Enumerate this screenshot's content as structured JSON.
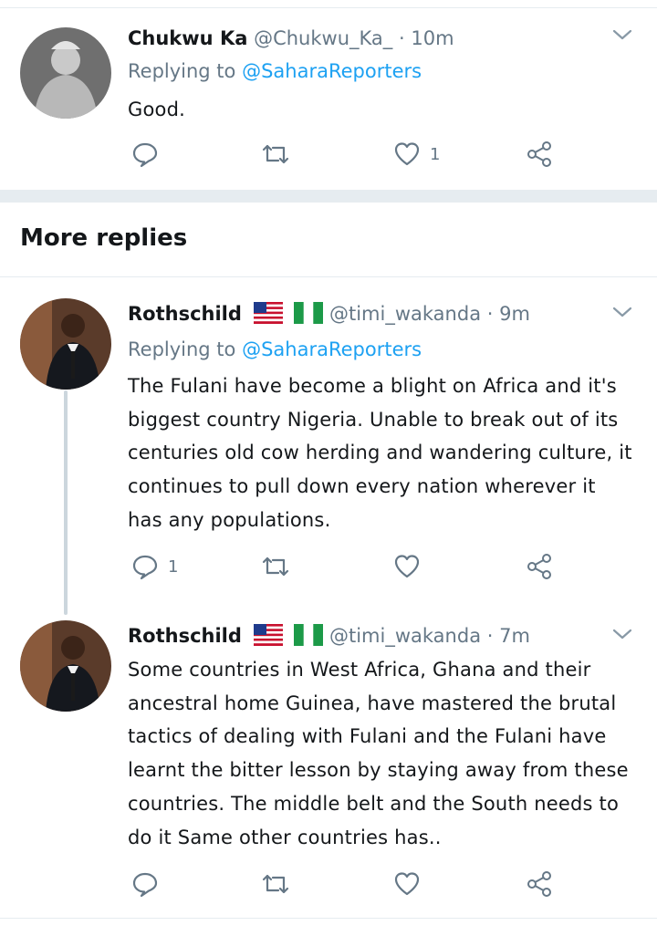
{
  "tweets": [
    {
      "name": "Chukwu Ka",
      "handle": "@Chukwu_Ka_",
      "separator": "·",
      "time": "10m",
      "replying_prefix": "Replying to",
      "replying_to": "@SaharaReporters",
      "text": "Good.",
      "reply_count": "",
      "like_count": "1"
    },
    {
      "name": "Rothschild",
      "flags": [
        "US flag",
        "Nigeria flag"
      ],
      "handle": "@timi_wakanda",
      "separator": "·",
      "time": "9m",
      "replying_prefix": "Replying to",
      "replying_to": "@SaharaReporters",
      "text": "The Fulani have become a blight on Africa and it's biggest country Nigeria. Unable to break out of its centuries old cow herding and wandering culture, it continues to pull down every nation wherever it has any populations.",
      "reply_count": "1",
      "like_count": ""
    },
    {
      "name": "Rothschild",
      "flags": [
        "US flag",
        "Nigeria flag"
      ],
      "handle": "@timi_wakanda",
      "separator": "·",
      "time": "7m",
      "text": "Some countries in West Africa, Ghana and their ancestral home Guinea, have mastered the brutal tactics of dealing with Fulani and the Fulani have learnt the bitter lesson by staying away from these countries. The middle belt and the South needs to do it Same other countries has..",
      "reply_count": "",
      "like_count": ""
    }
  ],
  "section_title": "More replies",
  "colors": {
    "text": "#14171a",
    "secondary": "#657786",
    "link": "#1da1f2",
    "divider": "#e6ecf0"
  },
  "icons": [
    "reply-icon",
    "retweet-icon",
    "like-icon",
    "share-icon",
    "chevron-down-icon"
  ]
}
